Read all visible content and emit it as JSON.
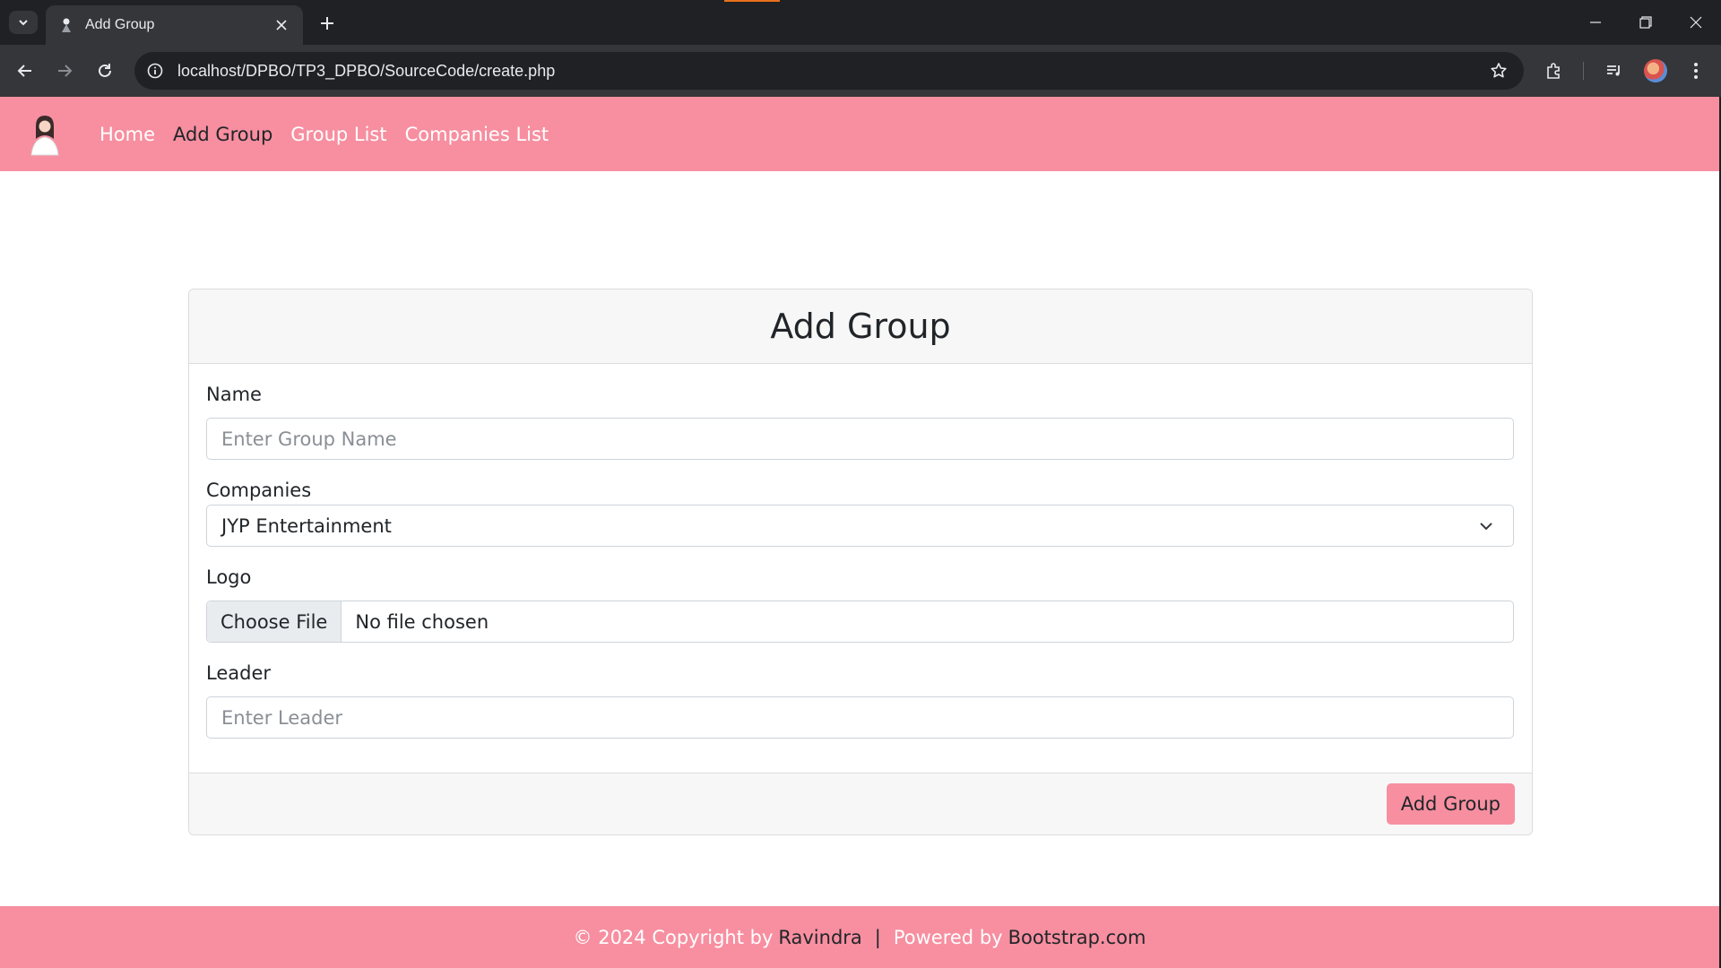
{
  "browser": {
    "tab_title": "Add Group",
    "url": "localhost/DPBO/TP3_DPBO/SourceCode/create.php"
  },
  "navbar": {
    "links": [
      {
        "label": "Home",
        "active": false
      },
      {
        "label": "Add Group",
        "active": true
      },
      {
        "label": "Group List",
        "active": false
      },
      {
        "label": "Companies List",
        "active": false
      }
    ]
  },
  "form": {
    "title": "Add Group",
    "name_label": "Name",
    "name_placeholder": "Enter Group Name",
    "companies_label": "Companies",
    "companies_selected": "JYP Entertainment",
    "logo_label": "Logo",
    "file_button": "Choose File",
    "file_status": "No file chosen",
    "leader_label": "Leader",
    "leader_placeholder": "Enter Leader",
    "submit_label": "Add Group"
  },
  "footer": {
    "copyright": "© 2024 Copyright by",
    "author": "Ravindra",
    "separator": "|",
    "powered": "Powered by",
    "powered_link": "Bootstrap.com"
  },
  "colors": {
    "brand_pink": "#f78fa0",
    "chrome_dark": "#202124",
    "chrome_mid": "#35363a"
  }
}
